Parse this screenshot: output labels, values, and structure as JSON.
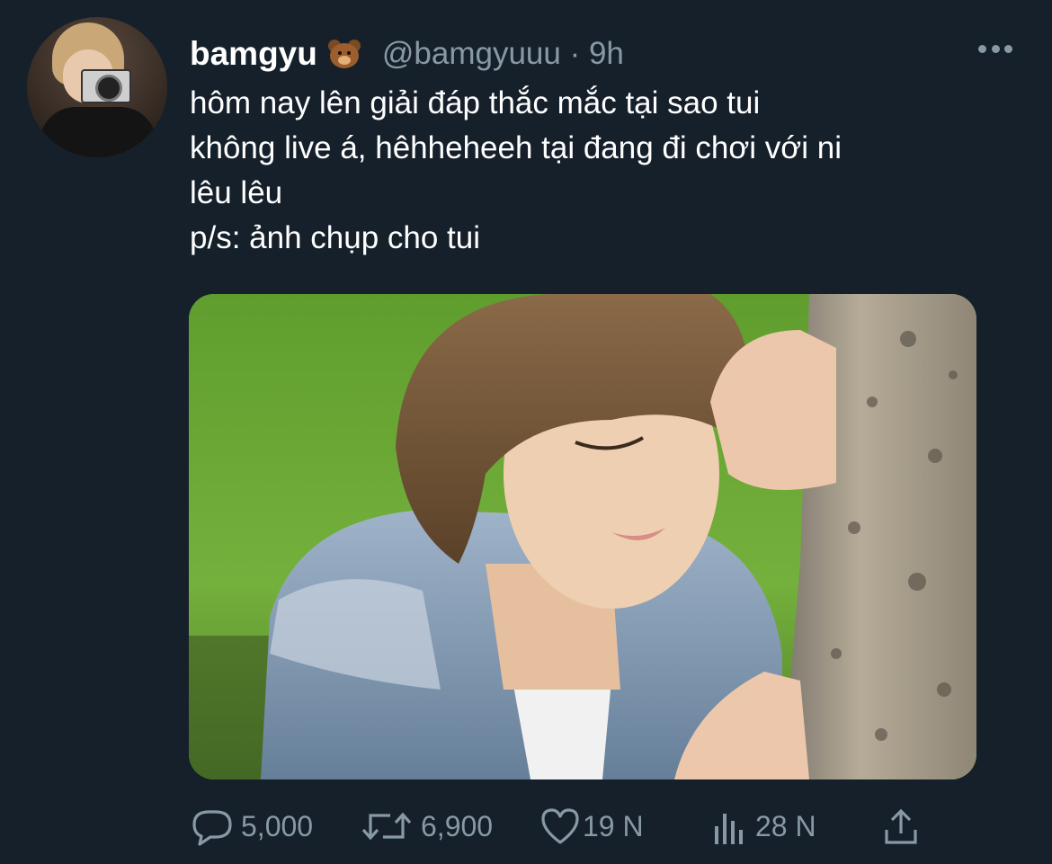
{
  "tweet": {
    "display_name": "bamgyu",
    "name_emoji": "bear-face-emoji",
    "handle": "@bamgyuuu",
    "separator": "·",
    "time": "9h",
    "text": "hôm nay lên giải đáp thắc mắc tại sao tui\nkhông live á, hêhheheeh tại đang đi chơi với ni\nlêu lêu\np/s: ảnh chụp cho tui"
  },
  "actions": {
    "reply_count": "5,000",
    "retweet_count": "6,900",
    "like_count": "19 N",
    "views_count": "28 N"
  },
  "icons": {
    "more": "more-dots-icon",
    "reply": "reply-bubble-icon",
    "retweet": "retweet-icon",
    "like": "heart-icon",
    "views": "analytics-icon",
    "share": "share-icon"
  },
  "colors": {
    "background": "#15202b",
    "text": "#ffffff",
    "secondary": "#8899a6"
  }
}
